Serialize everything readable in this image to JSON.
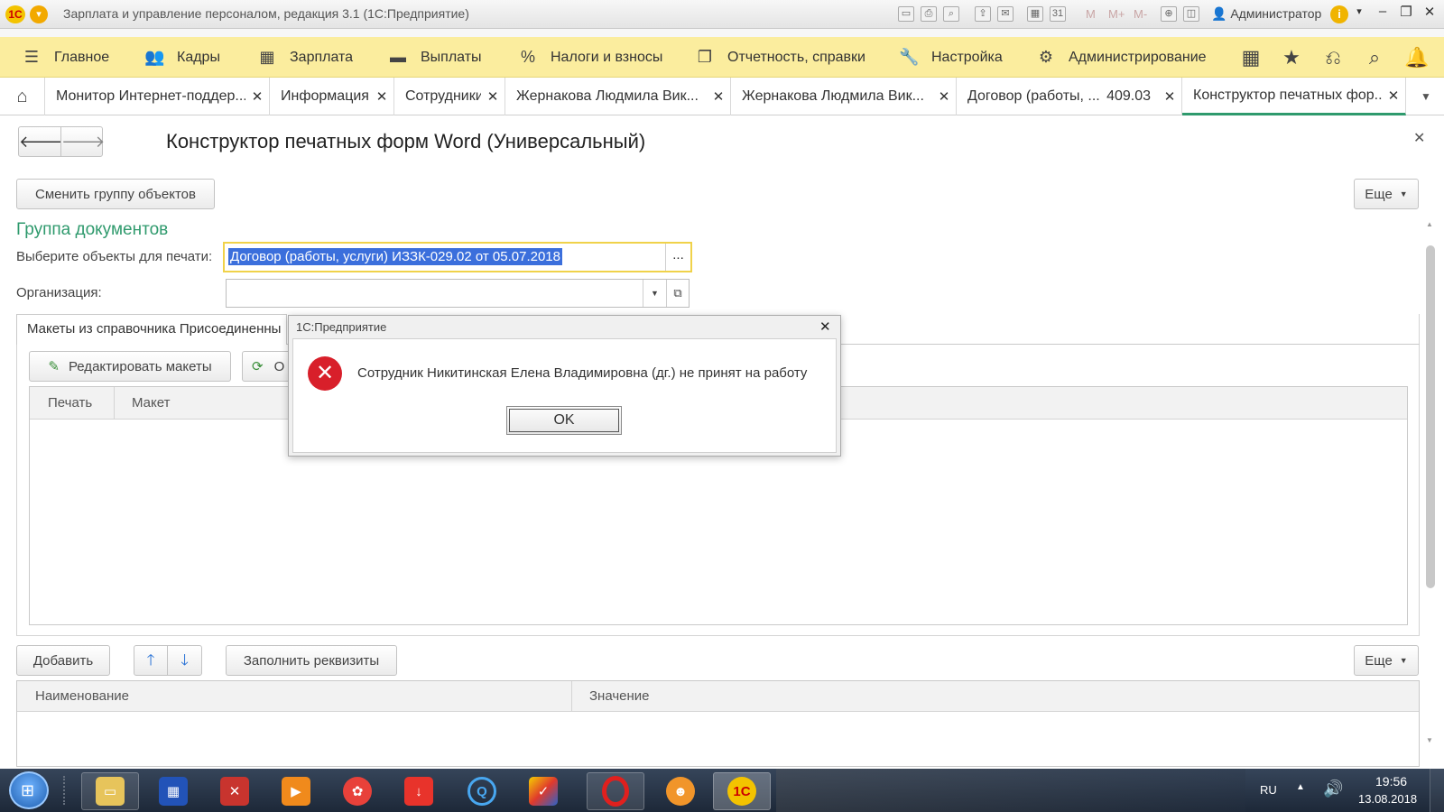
{
  "app": {
    "window_title": "Зарплата и управление персоналом, редакция 3.1  (1С:Предприятие)",
    "logo_text": "1С",
    "user": "Администратор",
    "toolbar_letters": [
      "M",
      "M+",
      "M-"
    ]
  },
  "main_menu": [
    {
      "label": "Главное",
      "icon": "hamburger-icon"
    },
    {
      "label": "Кадры",
      "icon": "people-icon"
    },
    {
      "label": "Зарплата",
      "icon": "calculator-icon"
    },
    {
      "label": "Выплаты",
      "icon": "wallet-icon"
    },
    {
      "label": "Налоги и взносы",
      "icon": "percent-icon"
    },
    {
      "label": "Отчетность, справки",
      "icon": "reports-icon"
    },
    {
      "label": "Настройка",
      "icon": "wrench-icon"
    },
    {
      "label": "Администрирование",
      "icon": "gear-icon"
    }
  ],
  "tabs": [
    {
      "label": "Монитор Интернет-поддер..."
    },
    {
      "label": "Информация"
    },
    {
      "label": "Сотрудники"
    },
    {
      "label": "Жернакова Людмила Вик..."
    },
    {
      "label": "Жернакова Людмила Вик..."
    },
    {
      "label": "Договор (работы, ...",
      "extra": "409.03"
    },
    {
      "label": "Конструктор печатных фор...",
      "active": true
    }
  ],
  "form": {
    "title": "Конструктор печатных форм Word (Универсальный)",
    "change_group_button": "Сменить группу объектов",
    "more_button": "Еще",
    "section_title": "Группа документов",
    "objects_label": "Выберите объекты для печати:",
    "objects_value": "Договор (работы, услуги) ИЗЗК-029.02 от 05.07.2018",
    "ellipsis": "...",
    "org_label": "Организация:",
    "org_value": "",
    "layouts_panel_title": "Макеты из справочника Присоединенны",
    "edit_layouts_button": "Редактировать макеты",
    "refresh_button_partial": "О",
    "layouts_columns": [
      "Печать",
      "Макет"
    ],
    "add_button": "Добавить",
    "fill_button": "Заполнить реквизиты",
    "more_button_2": "Еще",
    "props_columns": [
      "Наименование",
      "Значение"
    ]
  },
  "dialog": {
    "title": "1С:Предприятие",
    "message": "Сотрудник Никитинская Елена Владимировна (дг.) не принят на работу",
    "ok_button": "OK"
  },
  "taskbar": {
    "apps": [
      "explorer",
      "calculator",
      "pdf",
      "media-player",
      "downloader",
      "torrent",
      "browser-q",
      "ms-office",
      "opera",
      "game",
      "1c"
    ],
    "active_app": "1c",
    "lang": "RU",
    "time": "19:56",
    "date": "13.08.2018"
  },
  "colors": {
    "menu_bg": "#fbed9e",
    "section_green": "#2f9a6d",
    "selection_blue": "#3b6fdc",
    "error_red": "#d81f2a"
  }
}
